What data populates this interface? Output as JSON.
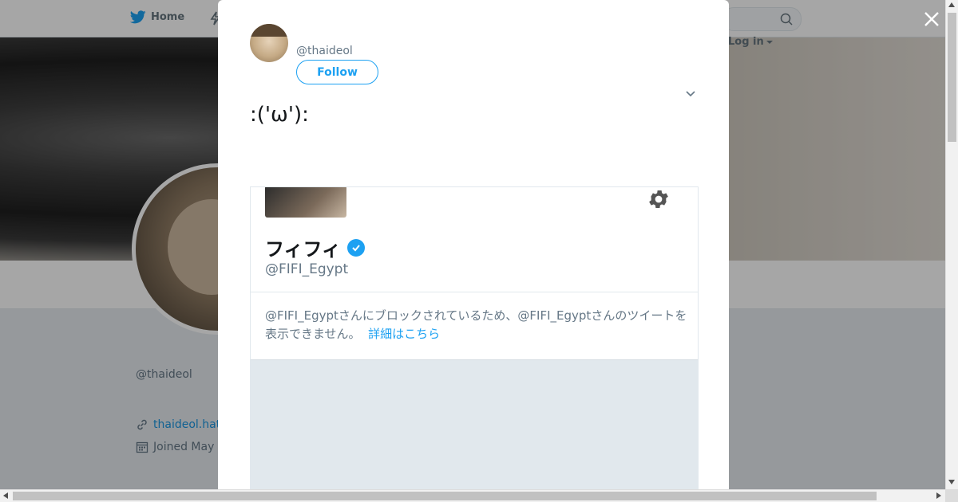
{
  "nav": {
    "home_label": "Home",
    "login_label": "Log in"
  },
  "profile": {
    "name": "",
    "handle": "@thaideol",
    "link_text": "thaideol.hat",
    "joined_text": "Joined May"
  },
  "tweet": {
    "handle": "@thaideol",
    "follow_label": "Follow",
    "text_lines": [
      ":('ω'):",
      "",
      ""
    ]
  },
  "embed": {
    "name": "フィフィ",
    "handle": "@FIFI_Egypt",
    "message": "@FIFI_Egyptさんにブロックされているため、@FIFI_Egyptさんのツイートを表示できません。",
    "more_link": "詳細はこちら"
  },
  "colors": {
    "accent": "#1da1f2",
    "text_primary": "#14171a",
    "text_secondary": "#657786"
  },
  "icons": {
    "home": "twitter-bird-icon",
    "moments": "lightning-icon",
    "search": "search-icon",
    "close": "close-icon",
    "chevron": "chevron-down-icon",
    "gear": "gear-icon",
    "verified": "verified-badge-icon",
    "link": "link-icon",
    "calendar": "calendar-icon"
  }
}
